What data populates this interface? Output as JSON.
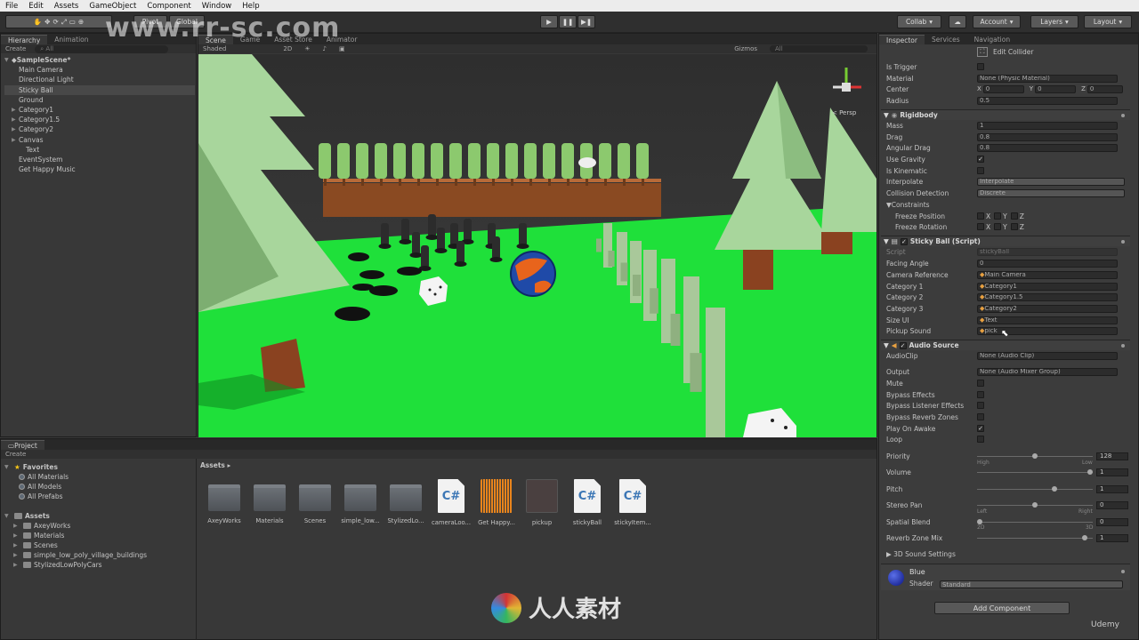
{
  "menu": [
    "File",
    "Edit",
    "Assets",
    "GameObject",
    "Component",
    "Window",
    "Help"
  ],
  "toolbar": {
    "pivot": "Pivot",
    "global": "Global",
    "collab": "Collab",
    "account": "Account",
    "layers": "Layers",
    "layout": "Layout"
  },
  "hierarchy": {
    "tab": "Hierarchy",
    "tab2": "Animation",
    "create": "Create",
    "search": "All",
    "scene": "SampleScene*",
    "items": [
      {
        "label": "Main Camera",
        "indent": 1,
        "arrow": false
      },
      {
        "label": "Directional Light",
        "indent": 1,
        "arrow": false
      },
      {
        "label": "Sticky Ball",
        "indent": 1,
        "arrow": false,
        "selected": true
      },
      {
        "label": "Ground",
        "indent": 1,
        "arrow": false
      },
      {
        "label": "Category1",
        "indent": 1,
        "arrow": true
      },
      {
        "label": "Category1.5",
        "indent": 1,
        "arrow": true
      },
      {
        "label": "Category2",
        "indent": 1,
        "arrow": true
      },
      {
        "label": "Canvas",
        "indent": 1,
        "arrow": true
      },
      {
        "label": "Text",
        "indent": 2,
        "arrow": false
      },
      {
        "label": "EventSystem",
        "indent": 1,
        "arrow": false
      },
      {
        "label": "Get Happy Music",
        "indent": 1,
        "arrow": false
      }
    ]
  },
  "sceneview": {
    "tabs": [
      "Scene",
      "Game",
      "Asset Store",
      "Animator"
    ],
    "shaded": "Shaded",
    "mode2d": "2D",
    "gizmos": "Gizmos",
    "search": "All",
    "persp": "< Persp"
  },
  "inspector": {
    "tabs": [
      "Inspector",
      "Services",
      "Navigation"
    ],
    "edit_collider": "Edit Collider",
    "collider": {
      "is_trigger": "Is Trigger",
      "material": "Material",
      "material_val": "None (Physic Material)",
      "center": "Center",
      "cx": "0",
      "cy": "0",
      "cz": "0",
      "radius": "Radius",
      "radius_val": "0.5"
    },
    "rigidbody": {
      "title": "Rigidbody",
      "mass": "Mass",
      "mass_val": "1",
      "drag": "Drag",
      "drag_val": "0.8",
      "angular": "Angular Drag",
      "angular_val": "0.8",
      "use_gravity": "Use Gravity",
      "kinematic": "Is Kinematic",
      "interpolate": "Interpolate",
      "interpolate_val": "Interpolate",
      "collision": "Collision Detection",
      "collision_val": "Discrete",
      "constraints": "Constraints",
      "freeze_pos": "Freeze Position",
      "freeze_rot": "Freeze Rotation",
      "x": "X",
      "y": "Y",
      "z": "Z"
    },
    "script": {
      "title": "Sticky Ball (Script)",
      "script": "Script",
      "script_val": "stickyBall",
      "facing": "Facing Angle",
      "facing_val": "0",
      "camera": "Camera Reference",
      "camera_val": "Main Camera",
      "cat1": "Category 1",
      "cat1_val": "Category1",
      "cat2": "Category 2",
      "cat2_val": "Category1.5",
      "cat3": "Category 3",
      "cat3_val": "Category2",
      "size": "Size UI",
      "size_val": "Text",
      "pickup": "Pickup Sound",
      "pickup_val": "pick"
    },
    "audio": {
      "title": "Audio Source",
      "clip": "AudioClip",
      "clip_val": "None (Audio Clip)",
      "output": "Output",
      "output_val": "None (Audio Mixer Group)",
      "mute": "Mute",
      "bypass": "Bypass Effects",
      "bypass_l": "Bypass Listener Effects",
      "bypass_r": "Bypass Reverb Zones",
      "play": "Play On Awake",
      "loop": "Loop",
      "priority": "Priority",
      "priority_val": "128",
      "high": "High",
      "low": "Low",
      "volume": "Volume",
      "volume_val": "1",
      "pitch": "Pitch",
      "pitch_val": "1",
      "stereo": "Stereo Pan",
      "stereo_val": "0",
      "left": "Left",
      "right": "Right",
      "spatial": "Spatial Blend",
      "spatial_val": "0",
      "d2": "2D",
      "d3": "3D",
      "reverb": "Reverb Zone Mix",
      "reverb_val": "1",
      "sound3d": "3D Sound Settings"
    },
    "material": {
      "name": "Blue",
      "shader": "Shader",
      "shader_val": "Standard"
    },
    "add_component": "Add Component"
  },
  "project": {
    "tab": "Project",
    "create": "Create",
    "favorites": "Favorites",
    "fav_items": [
      "All Materials",
      "All Models",
      "All Prefabs"
    ],
    "assets": "Assets",
    "asset_folders": [
      "AxeyWorks",
      "Materials",
      "Scenes",
      "simple_low_poly_village_buildings",
      "StylizedLowPolyCars"
    ],
    "breadcrumb": "Assets",
    "grid": [
      {
        "label": "AxeyWorks",
        "kind": "folder"
      },
      {
        "label": "Materials",
        "kind": "folder"
      },
      {
        "label": "Scenes",
        "kind": "folder"
      },
      {
        "label": "simple_low...",
        "kind": "folder"
      },
      {
        "label": "StylizedLo...",
        "kind": "folder"
      },
      {
        "label": "cameraLoo...",
        "kind": "script"
      },
      {
        "label": "Get Happy...",
        "kind": "audio"
      },
      {
        "label": "pickup",
        "kind": "audio2"
      },
      {
        "label": "stickyBall",
        "kind": "script"
      },
      {
        "label": "stickyItem...",
        "kind": "script"
      }
    ]
  },
  "watermark": "www.rr-sc.com",
  "brand": "人人素材",
  "udemy": "Udemy",
  "colors": {
    "grass": "#1fe03a",
    "menubar": "#ececec",
    "panel": "#383838",
    "ball": "#1f4aa8"
  }
}
